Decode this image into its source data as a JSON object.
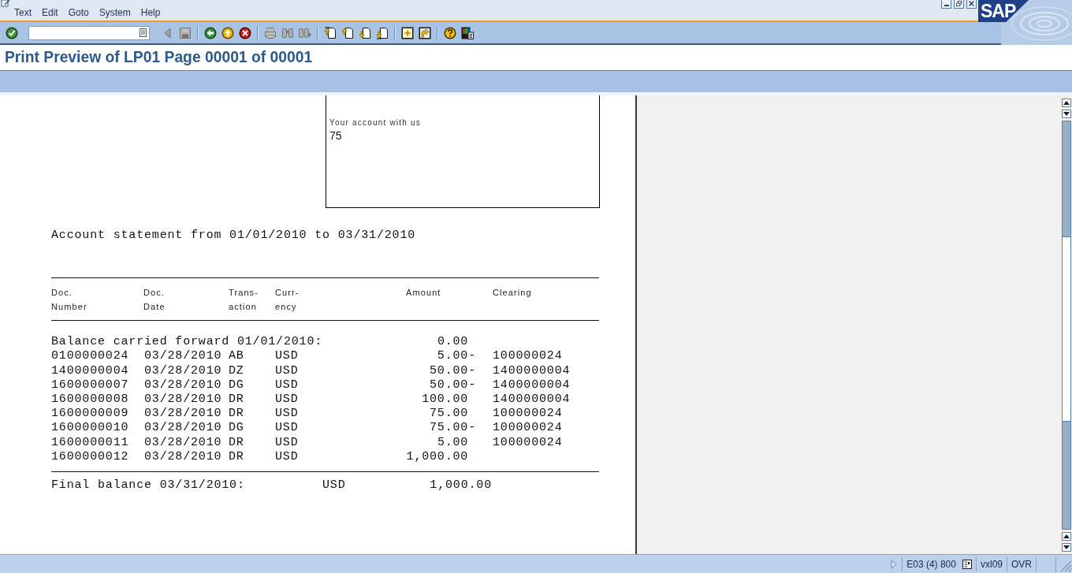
{
  "menu_bar": {
    "items": [
      "Text",
      "Edit",
      "Goto",
      "System",
      "Help"
    ],
    "logo": "SAP"
  },
  "toolbar": {
    "groups": [
      {
        "buttons": [
          {
            "kind": "enter",
            "disabled": false
          },
          {
            "kind": "command_field"
          },
          {
            "kind": "back_step",
            "disabled": true
          },
          {
            "kind": "save",
            "disabled": true
          }
        ]
      },
      {
        "buttons": [
          {
            "kind": "back",
            "disabled": false
          },
          {
            "kind": "exit",
            "disabled": false
          },
          {
            "kind": "cancel",
            "disabled": false
          }
        ]
      },
      {
        "buttons": [
          {
            "kind": "print",
            "disabled": true
          },
          {
            "kind": "find",
            "disabled": true
          },
          {
            "kind": "find_next",
            "disabled": true
          }
        ]
      },
      {
        "buttons": [
          {
            "kind": "first_page",
            "disabled": false
          },
          {
            "kind": "previous_page",
            "disabled": false
          },
          {
            "kind": "next_page",
            "disabled": false
          },
          {
            "kind": "last_page",
            "disabled": false
          }
        ]
      },
      {
        "buttons": [
          {
            "kind": "new_session",
            "disabled": false
          },
          {
            "kind": "shortcut",
            "disabled": false
          }
        ]
      },
      {
        "buttons": [
          {
            "kind": "help",
            "disabled": false
          },
          {
            "kind": "layout",
            "disabled": false
          }
        ]
      }
    ]
  },
  "title": "Print Preview of LP01 Page 00001 of 00001",
  "document": {
    "address_box": {
      "label": "Your account with us",
      "value": "75"
    },
    "statement_title": "Account statement from 01/01/2010 to 03/31/2010",
    "columns": [
      {
        "lines": [
          "Doc.",
          "Number"
        ]
      },
      {
        "lines": [
          "Doc.",
          "Date"
        ]
      },
      {
        "lines": [
          "Trans-",
          "action"
        ]
      },
      {
        "lines": [
          "Curr-",
          "ency"
        ]
      },
      {
        "lines": [
          "Amount"
        ]
      },
      {
        "lines": [
          "Clearing"
        ]
      }
    ],
    "opening_balance": {
      "label": "Balance carried forward 01/01/2010:",
      "amount": "0.00"
    },
    "rows": [
      {
        "doc_number": "0100000024",
        "doc_date": "03/28/2010",
        "transaction": "AB",
        "currency": "USD",
        "amount": "5.00-",
        "clearing": "100000024"
      },
      {
        "doc_number": "1400000004",
        "doc_date": "03/28/2010",
        "transaction": "DZ",
        "currency": "USD",
        "amount": "50.00-",
        "clearing": "1400000004"
      },
      {
        "doc_number": "1600000007",
        "doc_date": "03/28/2010",
        "transaction": "DG",
        "currency": "USD",
        "amount": "50.00-",
        "clearing": "1400000004"
      },
      {
        "doc_number": "1600000008",
        "doc_date": "03/28/2010",
        "transaction": "DR",
        "currency": "USD",
        "amount": "100.00",
        "clearing": "1400000004"
      },
      {
        "doc_number": "1600000009",
        "doc_date": "03/28/2010",
        "transaction": "DR",
        "currency": "USD",
        "amount": "75.00",
        "clearing": "100000024"
      },
      {
        "doc_number": "1600000010",
        "doc_date": "03/28/2010",
        "transaction": "DG",
        "currency": "USD",
        "amount": "75.00-",
        "clearing": "100000024"
      },
      {
        "doc_number": "1600000011",
        "doc_date": "03/28/2010",
        "transaction": "DR",
        "currency": "USD",
        "amount": "5.00",
        "clearing": "100000024"
      },
      {
        "doc_number": "1600000012",
        "doc_date": "03/28/2010",
        "transaction": "DR",
        "currency": "USD",
        "amount": "1,000.00"
      }
    ],
    "final_balance": {
      "label": "Final balance 03/31/2010:",
      "currency": "USD",
      "amount": "1,000.00"
    }
  },
  "status_bar": {
    "session": "E03 (4) 800",
    "server": "vxl09",
    "mode": "OVR"
  }
}
